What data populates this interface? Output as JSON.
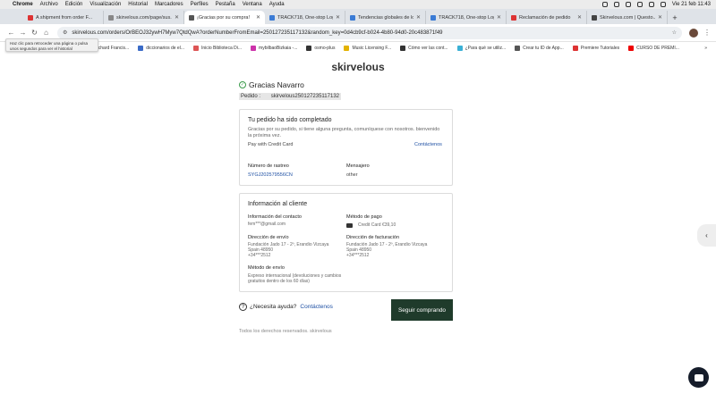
{
  "menubar": {
    "apple": "",
    "app": "Chrome",
    "items": [
      "Archivo",
      "Edición",
      "Visualización",
      "Historial",
      "Marcadores",
      "Perfiles",
      "Pestaña",
      "Ventana",
      "Ayuda"
    ],
    "clock": "Vie 21 feb 11:43"
  },
  "tabs": [
    {
      "label": "A shipment from order F...",
      "color": "#d33"
    },
    {
      "label": "skirvelous.com/page/sus...",
      "color": "#888"
    },
    {
      "label": "¡Gracias por su compra!",
      "color": "#555"
    },
    {
      "label": "TRACK718, One-stop Log...",
      "color": "#3a7bd5"
    },
    {
      "label": "Tendencias globales de lo...",
      "color": "#3a7bd5"
    },
    {
      "label": "TRACK718, One-stop Log...",
      "color": "#3a7bd5"
    },
    {
      "label": "Reclamación de pedido",
      "color": "#d33"
    },
    {
      "label": "Skirvelous.com | Questo...",
      "color": "#444"
    }
  ],
  "address": {
    "url": "skirvelous.com/orders/OrBEOJ32ywH7Myw7QtdQwA?orderNumberFromEmail=250127235117132&random_key=0d4cb9cf-b024-4b80-94d0-20c483871f49"
  },
  "bookmarks": [
    {
      "label": "Richard Francis...",
      "color": "#777"
    },
    {
      "label": "diccionarios de el...",
      "color": "#3a6bc7"
    },
    {
      "label": "Inicio Biblioteca Di...",
      "color": "#d55"
    },
    {
      "label": "mybilbaoBizkaia -...",
      "color": "#c3a"
    },
    {
      "label": "osmo-plus",
      "color": "#333"
    },
    {
      "label": "Music Licensing F...",
      "color": "#e3b200"
    },
    {
      "label": "Cómo ver las cont...",
      "color": "#333"
    },
    {
      "label": "¿Para qué se utiliz...",
      "color": "#3ab0d5"
    },
    {
      "label": "Crear tu ID de App...",
      "color": "#555"
    },
    {
      "label": "Premiere Tutoriales",
      "color": "#d33"
    },
    {
      "label": "CURSO DE PREMI...",
      "color": "#e00"
    }
  ],
  "bookmarks_more": "»",
  "tooltip": "Haz clic para retroceder una página o pulsa unos segundos para ver el historial",
  "page": {
    "brand": "skirvelous",
    "greeting": "Gracias  Navarro",
    "order_label": "Pedido :",
    "order_number": "skirvelous250127235117132",
    "status": {
      "title": "Tu pedido ha sido completado",
      "message": "Gracias por su pedido, si tiene alguna pregunta, comuníquese con nosotros. bienvenido la próxima vez.",
      "pay_label": "Pay with Credit Card",
      "contact_link": "Contáctenos",
      "tracking_label": "Número de rastreo",
      "tracking_number": "SYGJ202579556CN",
      "courier_label": "Mensajero",
      "courier_value": "other"
    },
    "customer": {
      "title": "Información al cliente",
      "contact_label": "Información del contacto",
      "contact_value": "fem***@gmail.com",
      "payment_label": "Método de pago",
      "payment_value": "Credit Card €39,10",
      "shipping_label": "Dirección de envío",
      "shipping_lines": [
        "Fundación Jado 17 - 2º, Erandio Vizcaya",
        "Spain 48950",
        "+34***2512"
      ],
      "billing_label": "Dirección de facturación",
      "billing_lines": [
        "Fundación Jado 17 - 2º, Erandio Vizcaya",
        "Spain 48950",
        "+34***2512"
      ],
      "method_label": "Método de envío",
      "method_value": "Expreso internacional (devoluciones y cambios gratuitos dentro de los 60 días)"
    },
    "help_label": "¿Necesita ayuda?",
    "help_link": "Contáctenos",
    "continue_button": "Seguir comprando",
    "footer": "Todos los derechos reservados. skirvelous"
  }
}
